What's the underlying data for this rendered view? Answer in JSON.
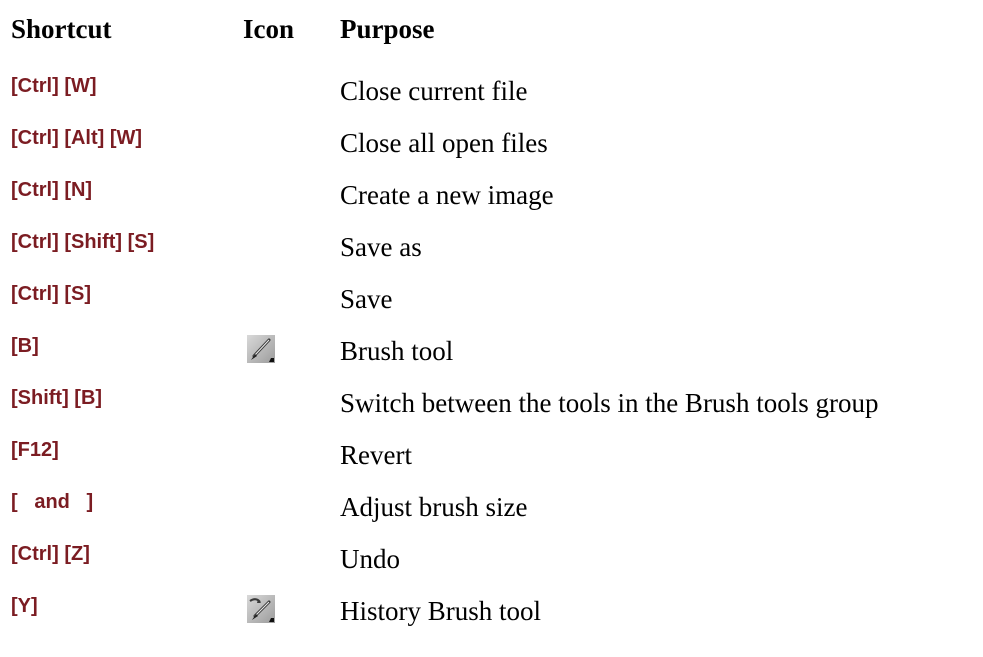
{
  "headers": {
    "shortcut": "Shortcut",
    "icon": "Icon",
    "purpose": "Purpose"
  },
  "rows": [
    {
      "shortcut": "[Ctrl] [W]",
      "icon": "",
      "purpose": "Close current file"
    },
    {
      "shortcut": "[Ctrl] [Alt] [W]",
      "icon": "",
      "purpose": "Close all open files"
    },
    {
      "shortcut": "[Ctrl] [N]",
      "icon": "",
      "purpose": "Create a new image"
    },
    {
      "shortcut": "[Ctrl] [Shift] [S]",
      "icon": "",
      "purpose": "Save as"
    },
    {
      "shortcut": "[Ctrl] [S]",
      "icon": "",
      "purpose": "Save"
    },
    {
      "shortcut": "[B]",
      "icon": "brush-tool-icon",
      "purpose": "Brush tool"
    },
    {
      "shortcut": "[Shift] [B]",
      "icon": "",
      "purpose": "Switch between the tools in the Brush tools group"
    },
    {
      "shortcut": "[F12]",
      "icon": "",
      "purpose": "Revert"
    },
    {
      "shortcut": "[   and   ]",
      "icon": "",
      "purpose": "Adjust brush size"
    },
    {
      "shortcut": "[Ctrl] [Z]",
      "icon": "",
      "purpose": "Undo"
    },
    {
      "shortcut": "[Y]",
      "icon": "history-brush-tool-icon",
      "purpose": "History Brush tool"
    }
  ],
  "colors": {
    "shortcut_text": "#7b1c22",
    "purpose_text": "#000000"
  }
}
